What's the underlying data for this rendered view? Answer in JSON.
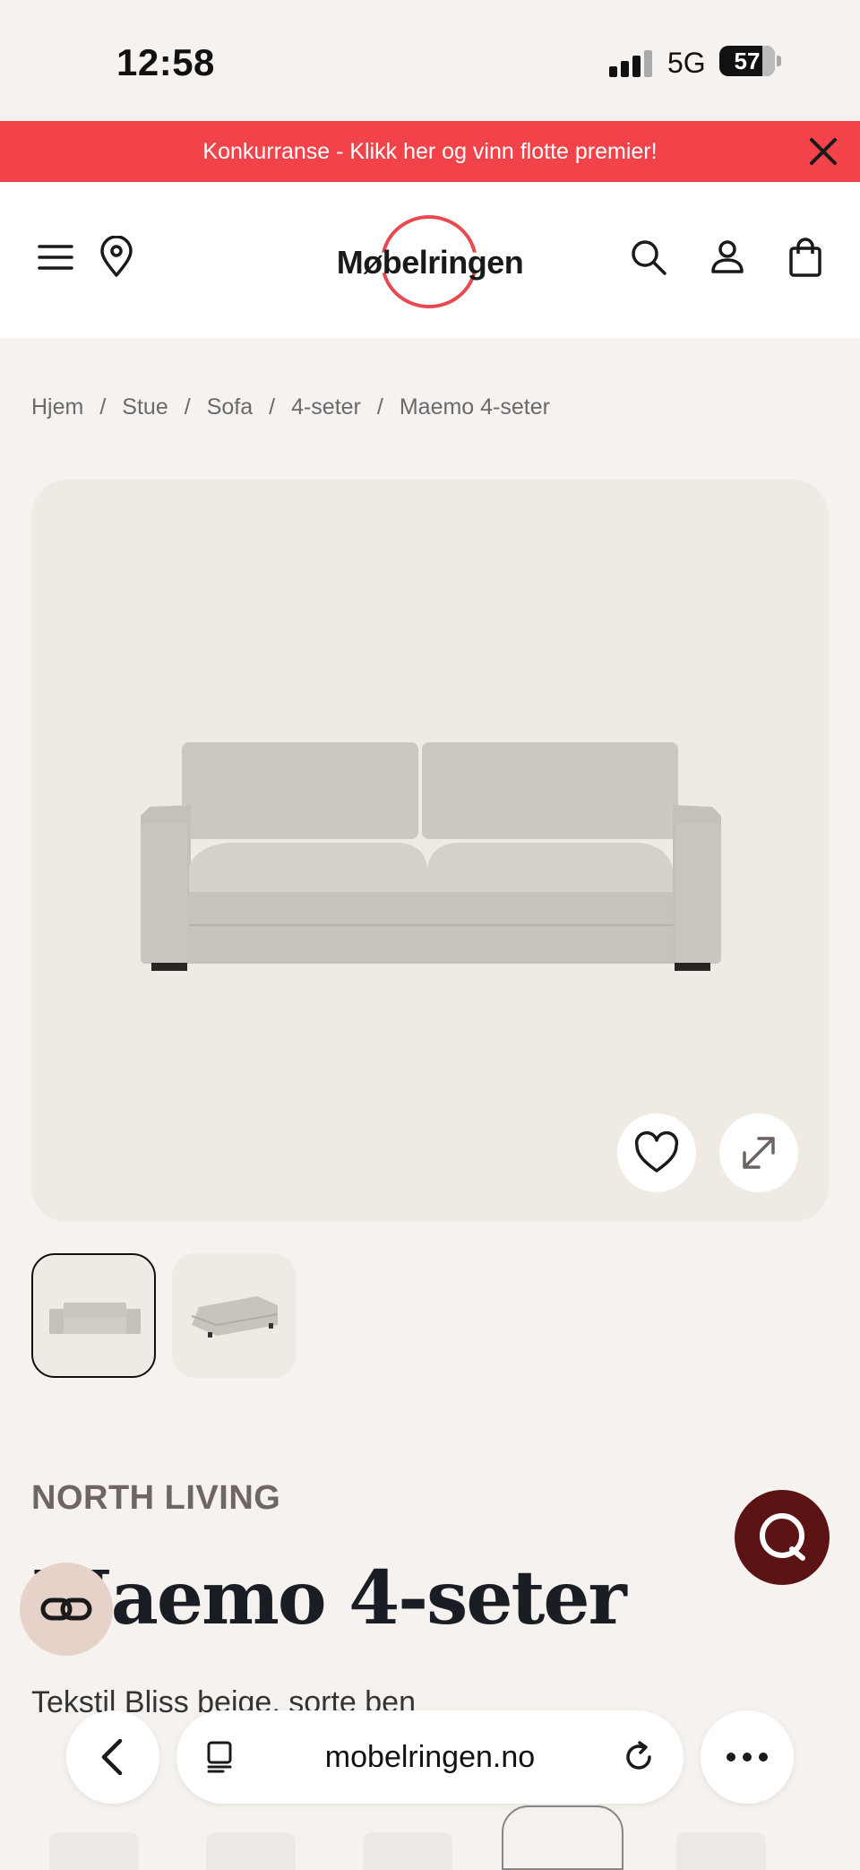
{
  "status_bar": {
    "time": "12:58",
    "network": "5G",
    "battery": "57"
  },
  "promo": {
    "text": "Konkurranse - Klikk her og vinn flotte premier!",
    "color": "#f2434a"
  },
  "header": {
    "logo": "Møbelringen",
    "icons": [
      "menu-icon",
      "location-pin-icon",
      "search-icon",
      "user-icon",
      "shopping-bag-icon"
    ],
    "accent": "#e84a4f"
  },
  "breadcrumb": [
    "Hjem",
    "Stue",
    "Sofa",
    "4-seter",
    "Maemo 4-seter"
  ],
  "breadcrumb_sep": "/",
  "gallery": {
    "actions": [
      "heart-icon",
      "expand-icon"
    ],
    "thumbnail_count": 2
  },
  "product": {
    "brand": "NORTH LIVING",
    "title": "Maemo 4-seter",
    "subtitle": "Tekstil Bliss beige, sorte ben"
  },
  "browser": {
    "url": "mobelringen.no"
  }
}
